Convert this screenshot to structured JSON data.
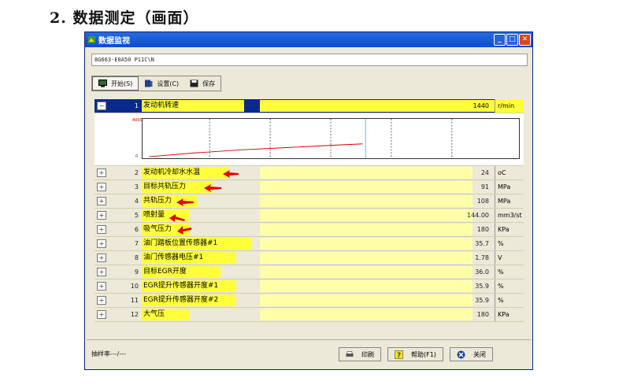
{
  "heading": "2. 数据测定（画面）",
  "window": {
    "title": "数据监视",
    "address": "8G663-E0A50 P11C\\N",
    "toolbar": {
      "start_label": "开始(S)",
      "settings_label": "设置(C)",
      "save_label": "保存"
    },
    "graph": {
      "y_max": "4000",
      "y_min": "0"
    },
    "rows": [
      {
        "num": "1",
        "label": "发动机转速",
        "value": "1440",
        "unit": "r/min",
        "toggle": "−"
      },
      {
        "num": "2",
        "label": "发动机冷却水水温",
        "value": "24",
        "unit": "oC",
        "toggle": "+"
      },
      {
        "num": "3",
        "label": "目标共轨压力",
        "value": "91",
        "unit": "MPa",
        "toggle": "+"
      },
      {
        "num": "4",
        "label": "共轨压力",
        "value": "108",
        "unit": "MPa",
        "toggle": "+"
      },
      {
        "num": "5",
        "label": "喷射量",
        "value": "144.00",
        "unit": "mm3/st",
        "toggle": "+"
      },
      {
        "num": "6",
        "label": "吸气压力",
        "value": "180",
        "unit": "KPa",
        "toggle": "+"
      },
      {
        "num": "7",
        "label": "油门踏板位置传感器#1",
        "value": "35.7",
        "unit": "%",
        "toggle": "+"
      },
      {
        "num": "8",
        "label": "油门传感器电压#1",
        "value": "1.78",
        "unit": "V",
        "toggle": "+"
      },
      {
        "num": "9",
        "label": "目标EGR开度",
        "value": "36.0",
        "unit": "%",
        "toggle": "+"
      },
      {
        "num": "10",
        "label": "EGR提升传感器开度#1",
        "value": "35.9",
        "unit": "%",
        "toggle": "+"
      },
      {
        "num": "11",
        "label": "EGR提升传感器开度#2",
        "value": "35.9",
        "unit": "%",
        "toggle": "+"
      },
      {
        "num": "12",
        "label": "大气压",
        "value": "180",
        "unit": "KPa",
        "toggle": "+"
      }
    ],
    "status": "抽样率---/---",
    "bottom": {
      "print_label": "印刷",
      "help_label": "帮助(F1)",
      "close_label": "关闭"
    },
    "colors": {
      "highlight": "#ffff3a",
      "selected_row": "#0a2a8a",
      "arrow": "#e00000"
    }
  }
}
